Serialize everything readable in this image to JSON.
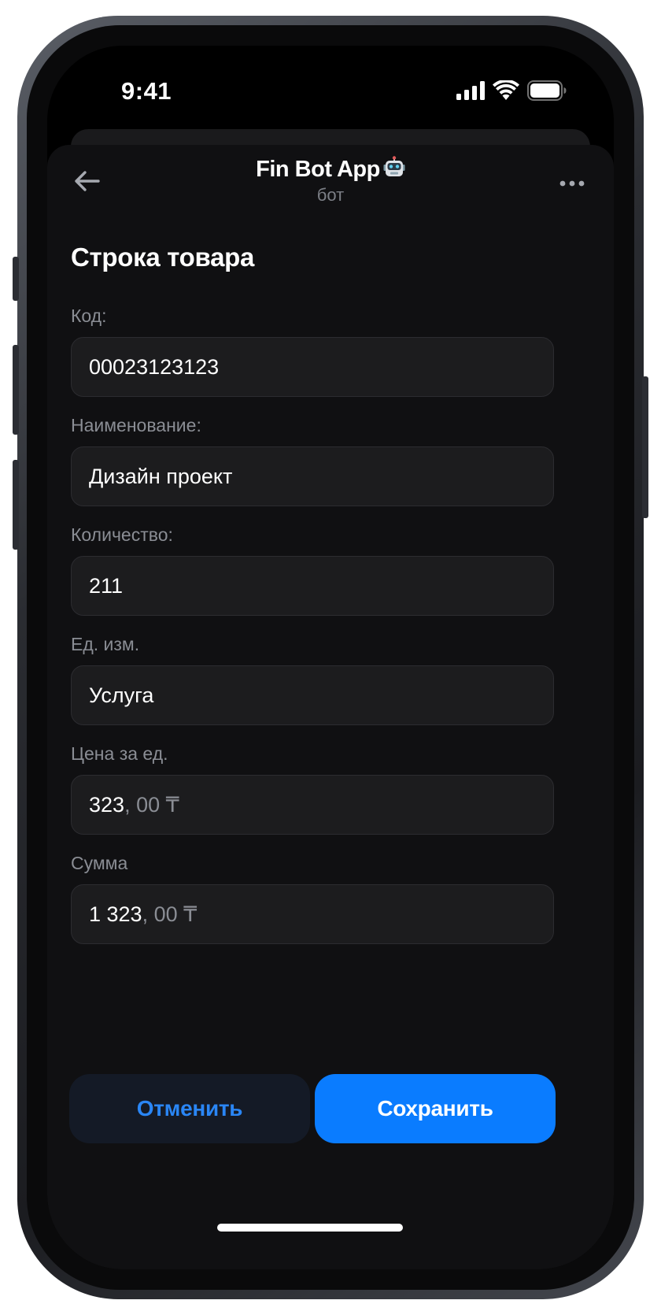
{
  "status_bar": {
    "time": "9:41",
    "icons": [
      "cellular-signal-icon",
      "wifi-icon",
      "battery-icon"
    ]
  },
  "header": {
    "title": "Fin Bot App",
    "title_emoji": "robot-icon",
    "subtitle": "бот",
    "back_icon": "arrow-left-icon",
    "more_icon": "more-horizontal-icon"
  },
  "form": {
    "title": "Строка товара",
    "fields": [
      {
        "label": "Код:",
        "value": "00023123123",
        "value_suffix": ""
      },
      {
        "label": "Наименование:",
        "value": "Дизайн проект",
        "value_suffix": ""
      },
      {
        "label": "Количество:",
        "value": "211",
        "value_suffix": ""
      },
      {
        "label": "Ед. изм.",
        "value": "Услуга",
        "value_suffix": ""
      },
      {
        "label": "Цена за ед.",
        "value": "323",
        "value_suffix": ", 00 ₸"
      },
      {
        "label": "Сумма",
        "value": "1 323",
        "value_suffix": ", 00 ₸"
      }
    ]
  },
  "actions": {
    "cancel_label": "Отменить",
    "save_label": "Сохранить"
  },
  "colors": {
    "accent": "#0a7cff",
    "cancel_text": "#2a86f5",
    "sheet_background": "#101012",
    "input_background": "#1c1c1e",
    "label_text": "#8a8d94"
  }
}
